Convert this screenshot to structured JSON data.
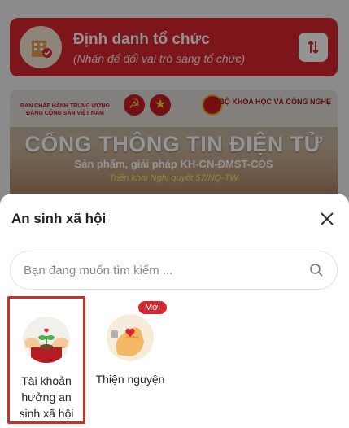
{
  "background": {
    "org_card": {
      "title": "Định danh tổ chức",
      "subtitle": "(Nhấn để đổi vai trò sang tổ chức)"
    },
    "banner": {
      "left_text": "BAN CHẤP HÀNH TRUNG ƯƠNG ĐẢNG CỘNG SẢN VIỆT NAM",
      "right_text": "BỘ KHOA HỌC VÀ CÔNG NGHỆ",
      "title": "CỔNG THÔNG TIN ĐIỆN TỬ",
      "subtitle": "Sản phẩm, giải pháp KH-CN-ĐMST-CĐS",
      "caption": "Triển khai Nghị quyết 57/NQ-TW"
    }
  },
  "sheet": {
    "title": "An sinh xã hội",
    "search": {
      "placeholder": "Bạn đang muốn tìm kiếm ..."
    },
    "services": [
      {
        "label": "Tài khoản hưởng an sinh xã hội",
        "icon": "plant-hands-icon",
        "highlighted": true
      },
      {
        "label": "Thiện nguyện",
        "icon": "charity-heart-hand-icon",
        "badge": "Mới"
      }
    ]
  },
  "colors": {
    "brand_red": "#d7262f",
    "highlight_border": "#c8302c"
  }
}
